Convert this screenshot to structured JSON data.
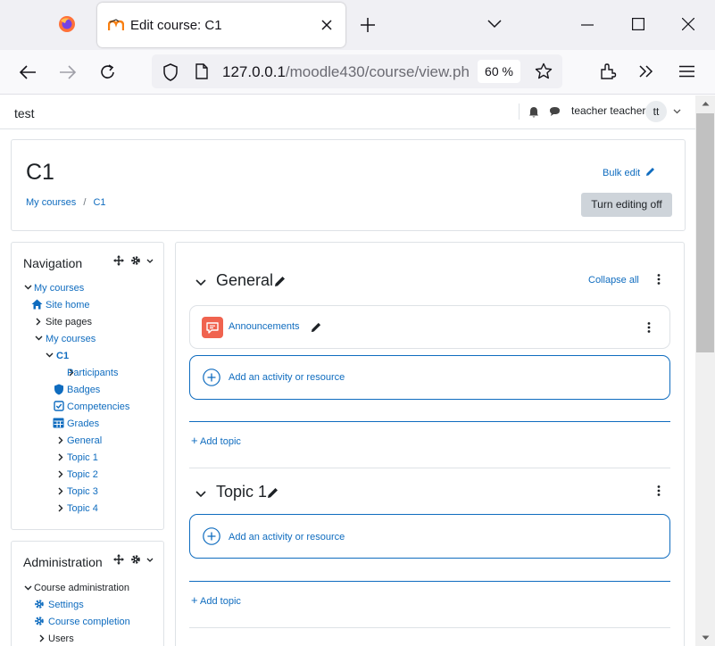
{
  "browser": {
    "tab_title": "Edit course: C1",
    "url_host": "127.0.0.1",
    "url_path": "/moodle430/course/view.ph",
    "zoom": "60 %"
  },
  "topnav": {
    "site_name": "test",
    "user_name": "teacher teacher",
    "user_initials": "tt"
  },
  "header": {
    "course_title": "C1",
    "bulk_edit": "Bulk edit",
    "turn_editing": "Turn editing off",
    "breadcrumb": [
      "My courses",
      "/",
      "C1"
    ]
  },
  "navigation": {
    "title": "Navigation",
    "items": [
      "My courses",
      "Site home",
      "Site pages",
      "My courses",
      "C1",
      "Participants",
      "Badges",
      "Competencies",
      "Grades",
      "General",
      "Topic 1",
      "Topic 2",
      "Topic 3",
      "Topic 4"
    ]
  },
  "administration": {
    "title": "Administration",
    "items": [
      "Course administration",
      "Settings",
      "Course completion",
      "Users"
    ]
  },
  "sections": [
    {
      "title": "General",
      "collapse_all": "Collapse all",
      "activity": "Announcements",
      "add_activity": "Add an activity or resource",
      "add_topic": "Add topic"
    },
    {
      "title": "Topic 1",
      "add_activity": "Add an activity or resource",
      "add_topic": "Add topic"
    }
  ],
  "colors": {
    "link": "#0f6cbf",
    "forum_icon": "#f0634f",
    "button": "#ced4da"
  }
}
